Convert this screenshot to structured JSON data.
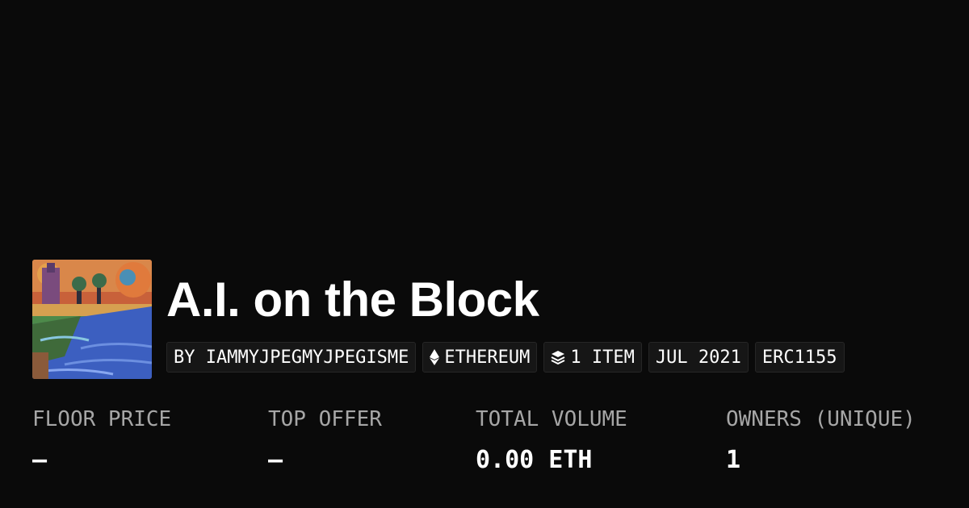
{
  "collection": {
    "title": "A.I. on the Block",
    "thumbnail_icon": "collection-artwork",
    "tags": [
      {
        "label": "BY IAMMYJPEGMYJPEGISME",
        "icon": ""
      },
      {
        "label": "ETHEREUM",
        "icon": "ethereum-icon"
      },
      {
        "label": "1 ITEM",
        "icon": "layers-icon"
      },
      {
        "label": "JUL 2021",
        "icon": ""
      },
      {
        "label": "ERC1155",
        "icon": ""
      }
    ]
  },
  "stats": [
    {
      "label": "FLOOR PRICE",
      "value": "—"
    },
    {
      "label": "TOP OFFER",
      "value": "—"
    },
    {
      "label": "TOTAL VOLUME",
      "value": "0.00 ETH"
    },
    {
      "label": "OWNERS (UNIQUE)",
      "value": "1"
    }
  ],
  "colors": {
    "background": "#0a0a0a",
    "text": "#ffffff",
    "muted": "#a6a6a6",
    "tag_bg": "#161616"
  }
}
